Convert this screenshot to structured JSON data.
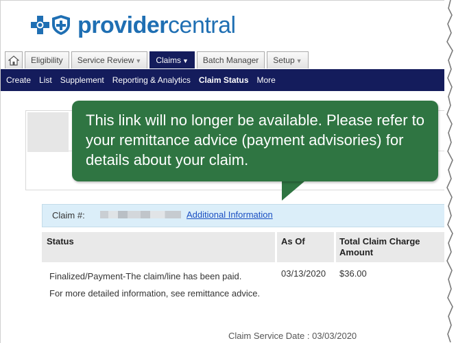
{
  "brand": {
    "name_bold": "provider",
    "name_light": "central"
  },
  "tabs": [
    {
      "label": "Eligibility",
      "caret": ""
    },
    {
      "label": "Service Review",
      "caret": "▼"
    },
    {
      "label": "Claims",
      "caret": "▼"
    },
    {
      "label": "Batch Manager",
      "caret": ""
    },
    {
      "label": "Setup",
      "caret": "▼"
    }
  ],
  "subnav": [
    "Create",
    "List",
    "Supplement",
    "Reporting & Analytics",
    "Claim Status",
    "More"
  ],
  "callout": {
    "text": "This link will no longer be available. Please refer to your remittance advice (payment advisories) for details about your claim."
  },
  "claim": {
    "label": "Claim #:",
    "link": "Additional Information"
  },
  "table": {
    "headers": [
      "Status",
      "As Of",
      "Total Claim Charge Amount"
    ],
    "row": {
      "status": "Finalized/Payment-The claim/line has been paid.",
      "as_of": "03/13/2020",
      "amount": "$36.00",
      "note": "For more detailed information, see remittance advice."
    },
    "service_date": "Claim Service Date : 03/03/2020"
  },
  "colors": {
    "nav": "#141c5c",
    "callout": "#2f7542",
    "brand": "#1f6fb3",
    "link": "#1a4fc2",
    "claim_bar": "#dbeef9"
  }
}
